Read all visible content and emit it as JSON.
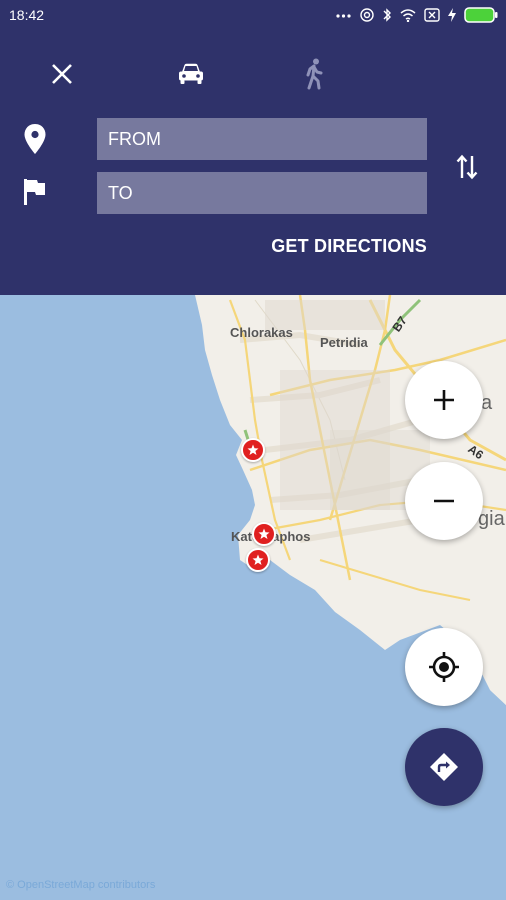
{
  "status": {
    "time": "18:42",
    "icons": [
      "more-dots-icon",
      "headset-icon",
      "bluetooth-icon",
      "wifi-icon",
      "sim-off-icon",
      "charging-icon",
      "battery-icon"
    ]
  },
  "header": {
    "modes": [
      {
        "name": "close-icon"
      },
      {
        "name": "car-icon",
        "selected": true
      },
      {
        "name": "walk-icon",
        "selected": false
      }
    ],
    "from_placeholder": "FROM",
    "to_placeholder": "TO",
    "get_directions_label": "GET DIRECTIONS",
    "color": "#2f326a"
  },
  "map": {
    "labels": {
      "chlorakas": "Chlorakas",
      "petridia": "Petridia",
      "kato_paphos": "Kato Paphos",
      "b7": "B7",
      "a6": "A6",
      "partial_a": "a",
      "partial_gia": "gia"
    },
    "water_color": "#9bbde0",
    "land_color": "#f2efe9",
    "marker_color": "#e02020",
    "attribution": "© OpenStreetMap contributors"
  },
  "controls": {
    "zoom_in_symbol": "+",
    "zoom_out_symbol": "−",
    "locate_icon": "gps-crosshair-icon",
    "route_icon": "directions-icon"
  }
}
